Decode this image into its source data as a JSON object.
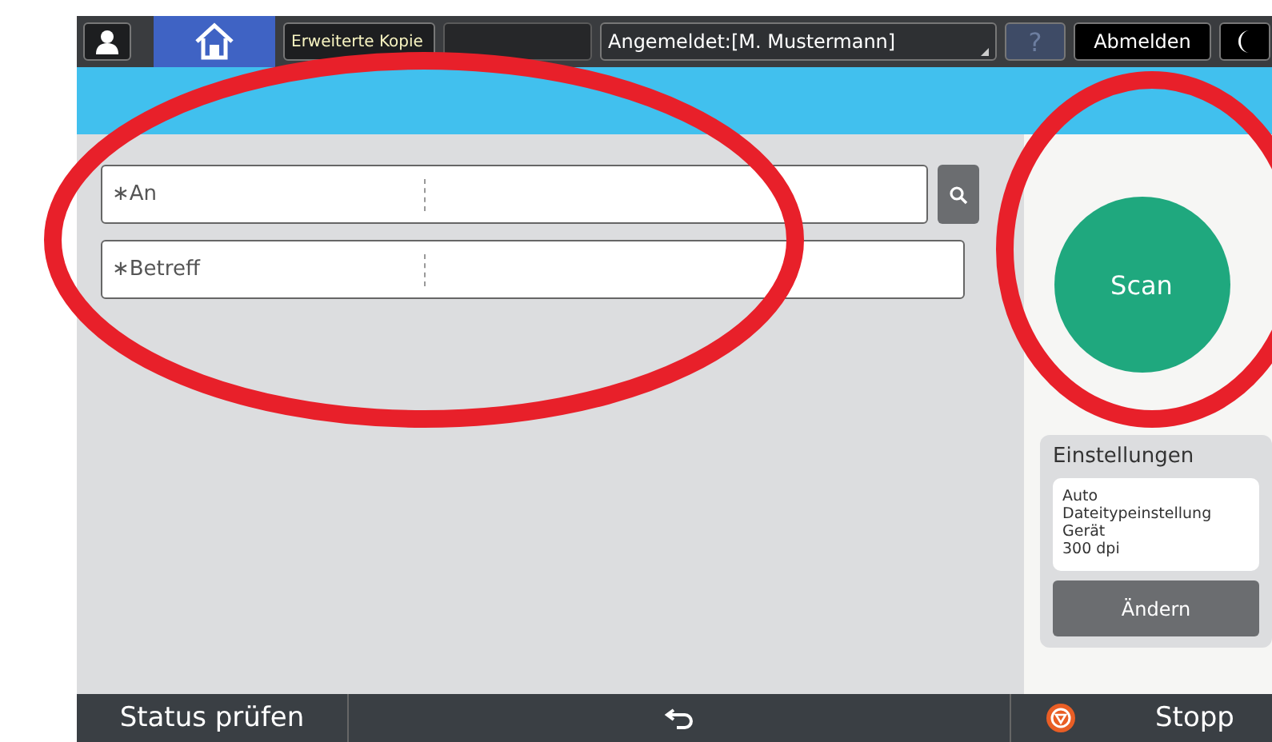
{
  "top_bar": {
    "home": {
      "selected": true
    },
    "tabs": [
      {
        "kind": "label",
        "label": "Erweiterte Kopie"
      },
      {
        "kind": "blank"
      }
    ],
    "login": "Angemeldet:[M. Mustermann]",
    "help": "?",
    "logout": "Abmelden"
  },
  "fields": [
    {
      "label": "∗An",
      "search": true
    },
    {
      "label": "∗Betreff",
      "search": false
    }
  ],
  "scan_button": "Scan",
  "settings": {
    "title": "Einstellungen",
    "lines": [
      "Auto",
      "Dateitypeinstellung",
      "Gerät",
      "300 dpi"
    ],
    "button": "Ändern"
  },
  "bottom_bar": {
    "status": "Status prüfen",
    "stop": "Stopp"
  },
  "annotations": [
    {
      "kind": "ellipse",
      "color": "#e8202a"
    },
    {
      "kind": "ellipse",
      "color": "#e8202a"
    }
  ]
}
